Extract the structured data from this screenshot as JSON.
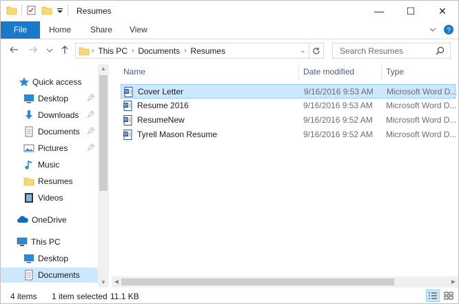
{
  "window": {
    "title": "Resumes",
    "minimize_glyph": "—",
    "maximize_glyph": "☐",
    "close_glyph": "✕"
  },
  "ribbon": {
    "tabs": [
      {
        "label": "File"
      },
      {
        "label": "Home"
      },
      {
        "label": "Share"
      },
      {
        "label": "View"
      }
    ]
  },
  "address": {
    "breadcrumbs": [
      "This PC",
      "Documents",
      "Resumes"
    ]
  },
  "search": {
    "placeholder": "Search Resumes"
  },
  "nav": {
    "items": [
      {
        "label": "Quick access",
        "icon": "star-icon",
        "pinned": false
      },
      {
        "label": "Desktop",
        "icon": "desktop-icon",
        "pinned": true
      },
      {
        "label": "Downloads",
        "icon": "download-icon",
        "pinned": true
      },
      {
        "label": "Documents",
        "icon": "document-icon",
        "pinned": true
      },
      {
        "label": "Pictures",
        "icon": "pictures-icon",
        "pinned": true
      },
      {
        "label": "Music",
        "icon": "music-icon",
        "pinned": false
      },
      {
        "label": "Resumes",
        "icon": "folder-icon",
        "pinned": false
      },
      {
        "label": "Videos",
        "icon": "video-icon",
        "pinned": false
      },
      {
        "label": "OneDrive",
        "icon": "cloud-icon",
        "pinned": false
      },
      {
        "label": "This PC",
        "icon": "computer-icon",
        "pinned": false
      },
      {
        "label": "Desktop",
        "icon": "desktop-icon",
        "pinned": false
      },
      {
        "label": "Documents",
        "icon": "document-icon",
        "pinned": false,
        "selected": true
      }
    ]
  },
  "columns": {
    "name": "Name",
    "date": "Date modified",
    "type": "Type"
  },
  "files": [
    {
      "name": "Cover Letter",
      "date": "9/16/2016 9:53 AM",
      "type": "Microsoft Word D...",
      "selected": true
    },
    {
      "name": "Resume 2016",
      "date": "9/16/2016 9:53 AM",
      "type": "Microsoft Word D..."
    },
    {
      "name": "ResumeNew",
      "date": "9/16/2016 9:52 AM",
      "type": "Microsoft Word D..."
    },
    {
      "name": "Tyrell Mason Resume",
      "date": "9/16/2016 9:52 AM",
      "type": "Microsoft Word D..."
    }
  ],
  "status": {
    "count": "4 items",
    "selection": "1 item selected",
    "size": "11.1 KB"
  },
  "colors": {
    "accent": "#1979ca",
    "selection": "#cce8ff",
    "folder": "#f8d775"
  }
}
